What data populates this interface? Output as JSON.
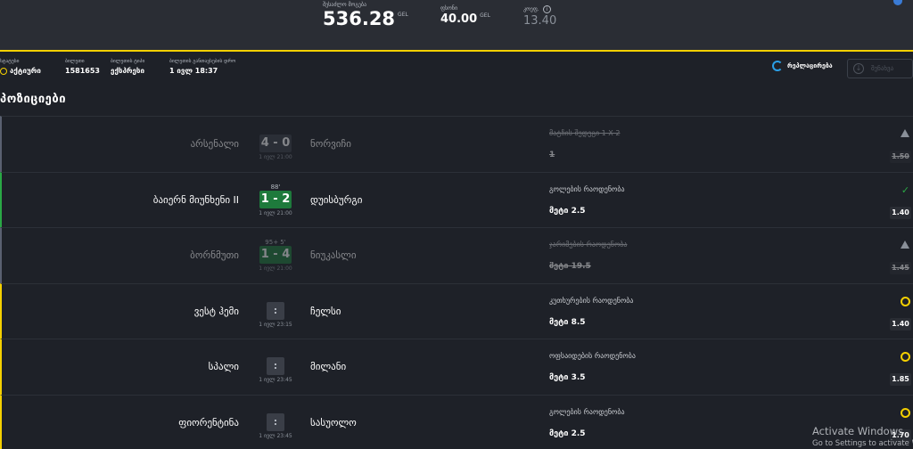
{
  "summary": {
    "payout_label": "შესაძლო მოგება",
    "payout_value": "536.28",
    "payout_unit": "GEL",
    "stake_label": "ფსონი",
    "stake_value": "40.00",
    "stake_unit": "GEL",
    "coef_label": "კოეფ.",
    "coef_value": "13.40"
  },
  "info": {
    "status_label": "სტატუსი",
    "status_value": "აქტიური",
    "id_label": "ბილეთი",
    "id_value": "1581653",
    "type_label": "ბილეთის ტიპი",
    "type_value": "ექსპრესი",
    "date_label": "ბილეთის განთავსების დრო",
    "date_value": "1 ივლ 18:37",
    "repeat_label": "რეპლაცირება",
    "save_label": "შენახვა"
  },
  "section_title": "პოზიციები",
  "positions": [
    {
      "home": "არსენალი",
      "away": "ნორვიჩი",
      "minute": "",
      "score": "4 - 0",
      "kickoff": "1 ივლ 21:00",
      "market": "მატჩის შედეგი 1 X 2",
      "pick": "1",
      "odd": "1.50",
      "state": "warn"
    },
    {
      "home": "ბაიერნ მიუნხენი II",
      "away": "დუისბურგი",
      "minute": "88'",
      "score": "1 - 2",
      "kickoff": "1 ივლ 21:00",
      "market": "გოლების რაოდენობა",
      "pick": "მეტი 2.5",
      "odd": "1.40",
      "state": "check"
    },
    {
      "home": "ბორნმუთი",
      "away": "ნიუკასლი",
      "minute": "95+ 5'",
      "score": "1 - 4",
      "kickoff": "1 ივლ 21:00",
      "market": "ჯარიმების რაოდენობა",
      "pick": "მეტი 19.5",
      "odd": "1.45",
      "state": "warn"
    },
    {
      "home": "ვესტ ჰემი",
      "away": "ჩელსი",
      "minute": "",
      "score": ":",
      "kickoff": "1 ივლ 23:15",
      "market": "კუთხურების რაოდენობა",
      "pick": "მეტი 8.5",
      "odd": "1.40",
      "state": "circle"
    },
    {
      "home": "სპალი",
      "away": "მილანი",
      "minute": "",
      "score": ":",
      "kickoff": "1 ივლ 23:45",
      "market": "ოფსაიდების რაოდენობა",
      "pick": "მეტი 3.5",
      "odd": "1.85",
      "state": "circle"
    },
    {
      "home": "ფიორენტინა",
      "away": "სასუოლო",
      "minute": "",
      "score": ":",
      "kickoff": "1 ივლ 23:45",
      "market": "გოლების რაოდენობა",
      "pick": "მეტი 2.5",
      "odd": "1.70",
      "state": "circle"
    }
  ],
  "watermark": {
    "title": "Activate Windows",
    "subtitle": "Go to Settings to activate Windows."
  }
}
